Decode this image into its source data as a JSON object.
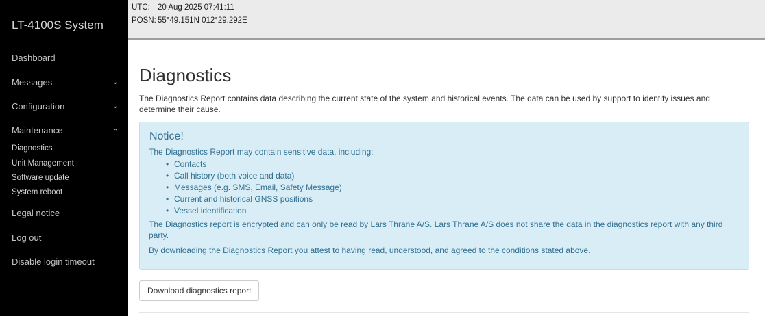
{
  "sidebar": {
    "brand": "LT-4100S System",
    "items": [
      {
        "label": "Dashboard",
        "chevron": ""
      },
      {
        "label": "Messages",
        "chevron": "⌄"
      },
      {
        "label": "Configuration",
        "chevron": "⌄"
      },
      {
        "label": "Maintenance",
        "chevron": "⌃"
      }
    ],
    "subitems": [
      "Diagnostics",
      "Unit Management",
      "Software update",
      "System reboot"
    ],
    "bottom_items": [
      "Legal notice",
      "Log out",
      "Disable login timeout"
    ]
  },
  "status": {
    "utc_label": "UTC:",
    "utc_value": "20 Aug 2025 07:41:11",
    "posn_label": "POSN:",
    "posn_value": "55°49.151N 012°29.292E"
  },
  "main": {
    "title": "Diagnostics",
    "intro": "The Diagnostics Report contains data describing the current state of the system and historical events. The data can be used by support to identify issues and determine their cause.",
    "notice": {
      "title": "Notice!",
      "lead": "The Diagnostics Report may contain sensitive data, including:",
      "items": [
        "Contacts",
        "Call history (both voice and data)",
        "Messages (e.g. SMS, Email, Safety Message)",
        "Current and historical GNSS positions",
        "Vessel identification"
      ],
      "para1": "The Diagnostics report is encrypted and can only be read by Lars Thrane A/S. Lars Thrane A/S does not share the data in the diagnostics report with any third party.",
      "para2": "By downloading the Diagnostics Report you attest to having read, understood, and agreed to the conditions stated above."
    },
    "download_label": "Download diagnostics report"
  }
}
